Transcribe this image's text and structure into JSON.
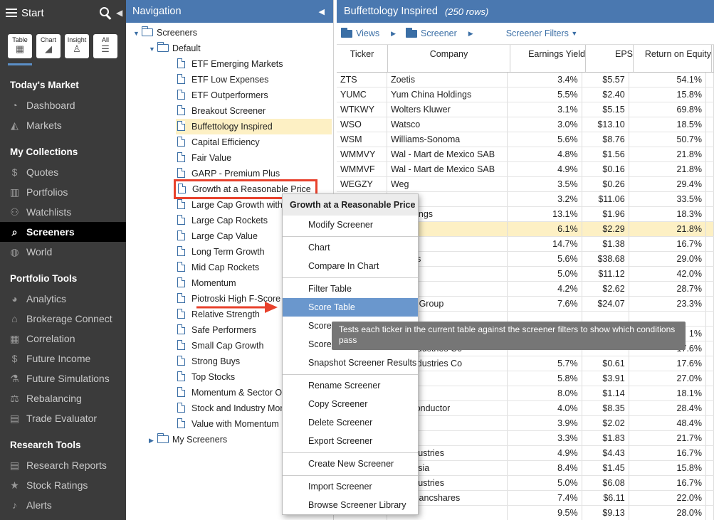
{
  "sidebar": {
    "title": "Start",
    "view_buttons": [
      {
        "label": "Table",
        "glyph": "▦",
        "icon": "table-icon"
      },
      {
        "label": "Chart",
        "glyph": "◢",
        "icon": "chart-icon"
      },
      {
        "label": "Insight",
        "glyph": "♙",
        "icon": "insight-icon"
      },
      {
        "label": "All",
        "glyph": "☰",
        "icon": "all-icon"
      }
    ],
    "sections": [
      {
        "title": "Today's Market",
        "items": [
          {
            "label": "Dashboard",
            "glyph": "◔",
            "icon": "dashboard-icon"
          },
          {
            "label": "Markets",
            "glyph": "◭",
            "icon": "markets-icon"
          }
        ]
      },
      {
        "title": "My Collections",
        "items": [
          {
            "label": "Quotes",
            "glyph": "$",
            "icon": "quotes-icon"
          },
          {
            "label": "Portfolios",
            "glyph": "▥",
            "icon": "portfolios-icon"
          },
          {
            "label": "Watchlists",
            "glyph": "⚇",
            "icon": "binoculars-icon"
          },
          {
            "label": "Screeners",
            "glyph": "⌕",
            "icon": "screeners-icon",
            "active": true
          },
          {
            "label": "World",
            "glyph": "◍",
            "icon": "globe-icon"
          }
        ]
      },
      {
        "title": "Portfolio Tools",
        "items": [
          {
            "label": "Analytics",
            "glyph": "◕",
            "icon": "analytics-icon"
          },
          {
            "label": "Brokerage Connect",
            "glyph": "⌂",
            "icon": "bank-icon"
          },
          {
            "label": "Correlation",
            "glyph": "▦",
            "icon": "correlation-icon"
          },
          {
            "label": "Future Income",
            "glyph": "$",
            "icon": "dollar-icon"
          },
          {
            "label": "Future Simulations",
            "glyph": "⚗",
            "icon": "flask-icon"
          },
          {
            "label": "Rebalancing",
            "glyph": "⚖",
            "icon": "scale-icon"
          },
          {
            "label": "Trade Evaluator",
            "glyph": "▤",
            "icon": "calculator-icon"
          }
        ]
      },
      {
        "title": "Research Tools",
        "items": [
          {
            "label": "Research Reports",
            "glyph": "▤",
            "icon": "report-icon"
          },
          {
            "label": "Stock Ratings",
            "glyph": "★",
            "icon": "star-icon"
          },
          {
            "label": "Alerts",
            "glyph": "♪",
            "icon": "bell-icon"
          }
        ]
      }
    ]
  },
  "navigation": {
    "title": "Navigation",
    "root": "Screeners",
    "group": "Default",
    "items": [
      "ETF Emerging Markets",
      "ETF Low Expenses",
      "ETF Outperformers",
      "Breakout Screener",
      "Buffettology Inspired",
      "Capital Efficiency",
      "Fair Value",
      "GARP - Premium Plus",
      "Growth at a Reasonable Price",
      "Large Cap Growth with",
      "Large Cap Rockets",
      "Large Cap Value",
      "Long Term Growth",
      "Mid Cap Rockets",
      "Momentum",
      "Piotroski High F-Score",
      "Relative Strength",
      "Safe Performers",
      "Small Cap Growth",
      "Strong Buys",
      "Top Stocks",
      "Momentum & Sector Ou",
      "Stock and Industry Mor",
      "Value with Momentum"
    ],
    "selected_index": 4,
    "boxed_index": 8,
    "my_screeners": "My Screeners"
  },
  "main": {
    "title": "Buffettology Inspired",
    "rows_label": "(250 rows)",
    "toolbar": {
      "views": "Views",
      "screener": "Screener",
      "filters": "Screener Filters"
    },
    "columns": [
      "Ticker",
      "Company",
      "Earnings Yield",
      "EPS",
      "Return on Equity"
    ],
    "rows": [
      [
        "ZTS",
        "Zoetis",
        "3.4%",
        "$5.57",
        "54.1%"
      ],
      [
        "YUMC",
        "Yum China Holdings",
        "5.5%",
        "$2.40",
        "15.8%"
      ],
      [
        "WTKWY",
        "Wolters Kluwer",
        "3.1%",
        "$5.15",
        "69.8%"
      ],
      [
        "WSO",
        "Watsco",
        "3.0%",
        "$13.10",
        "18.5%"
      ],
      [
        "WSM",
        "Williams-Sonoma",
        "5.6%",
        "$8.76",
        "50.7%"
      ],
      [
        "WMMVY",
        "Wal - Mart de Mexico SAB",
        "4.8%",
        "$1.56",
        "21.8%"
      ],
      [
        "WMMVF",
        "Wal - Mart de Mexico SAB",
        "4.9%",
        "$0.16",
        "21.8%"
      ],
      [
        "WEGZY",
        "Weg",
        "3.5%",
        "$0.26",
        "29.4%"
      ],
      [
        "",
        "",
        "3.2%",
        "$11.06",
        "33.5%"
      ],
      [
        "",
        "p Holdings",
        "13.1%",
        "$1.96",
        "18.3%"
      ],
      [
        "",
        "Line",
        "6.1%",
        "$2.29",
        "21.8%"
      ],
      [
        "",
        "",
        "14.7%",
        "$1.38",
        "16.7%"
      ],
      [
        "",
        "Rentals",
        "5.6%",
        "$38.68",
        "29.0%"
      ],
      [
        "",
        "Pacific",
        "5.0%",
        "$11.12",
        "42.0%"
      ],
      [
        "",
        "er",
        "4.2%",
        "$2.62",
        "28.7%"
      ],
      [
        "",
        "Health Group",
        "7.6%",
        "$24.07",
        "23.3%"
      ],
      [
        "",
        "",
        "",
        "",
        ""
      ],
      [
        "",
        "",
        "",
        "",
        "1%"
      ],
      [
        "",
        "onic Industries Co",
        "",
        "",
        "17.6%"
      ],
      [
        "",
        "onic Industries Co",
        "5.7%",
        "$0.61",
        "17.6%"
      ],
      [
        "",
        "",
        "5.8%",
        "$3.91",
        "27.0%"
      ],
      [
        "",
        "",
        "8.0%",
        "$1.14",
        "18.1%"
      ],
      [
        "",
        "Semiconductor",
        "4.0%",
        "$8.35",
        "28.4%"
      ],
      [
        "",
        "Supply",
        "3.9%",
        "$2.02",
        "48.4%"
      ],
      [
        "",
        "o",
        "3.3%",
        "$1.83",
        "21.7%"
      ],
      [
        "",
        "ont Industries",
        "4.9%",
        "$4.43",
        "16.7%"
      ],
      [
        "",
        "Indonesia",
        "8.4%",
        "$1.45",
        "15.8%"
      ],
      [
        "",
        "ont Industries",
        "5.0%",
        "$6.08",
        "16.7%"
      ],
      [
        "",
        "sville Bancshares",
        "7.4%",
        "$6.11",
        "22.0%"
      ],
      [
        "",
        "",
        "9.5%",
        "$9.13",
        "28.0%"
      ]
    ],
    "highlighted_row": 10
  },
  "context_menu": {
    "title": "Growth at a Reasonable Price",
    "groups": [
      [
        "Modify Screener"
      ],
      [
        "Chart",
        "Compare In Chart"
      ],
      [
        "Filter Table",
        "Score Table",
        "Score",
        "Score",
        "Snapshot Screener Results"
      ],
      [
        "Rename Screener",
        "Copy Screener",
        "Delete Screener",
        "Export Screener"
      ],
      [
        "Create New Screener"
      ],
      [
        "Import Screener",
        "Browse Screener Library"
      ]
    ],
    "hovered": "Score Table"
  },
  "tooltip": "Tests each ticker in the current table against the screener filters to show which conditions pass",
  "colors": {
    "header_blue": "#4a78b0",
    "sidebar_bg": "#3b3b3b",
    "highlight": "#fdf0c4",
    "callout_red": "#e8412c",
    "menu_hover": "#6a97cd"
  }
}
